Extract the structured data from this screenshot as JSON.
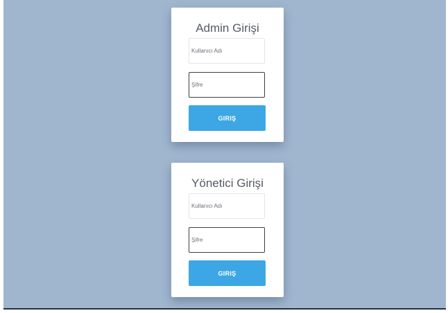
{
  "colors": {
    "background": "#a0b6cf",
    "card": "#ffffff",
    "button": "#3ca7e4",
    "button_text": "#ffffff"
  },
  "forms": [
    {
      "title": "Admin Girişi",
      "username_placeholder": "Kullanıcı Adı",
      "password_placeholder": "Şifre",
      "submit_label": "GIRIŞ"
    },
    {
      "title": "Yönetici Girişi",
      "username_placeholder": "Kullanıcı Adı",
      "password_placeholder": "Şifre",
      "submit_label": "GIRIŞ"
    }
  ]
}
